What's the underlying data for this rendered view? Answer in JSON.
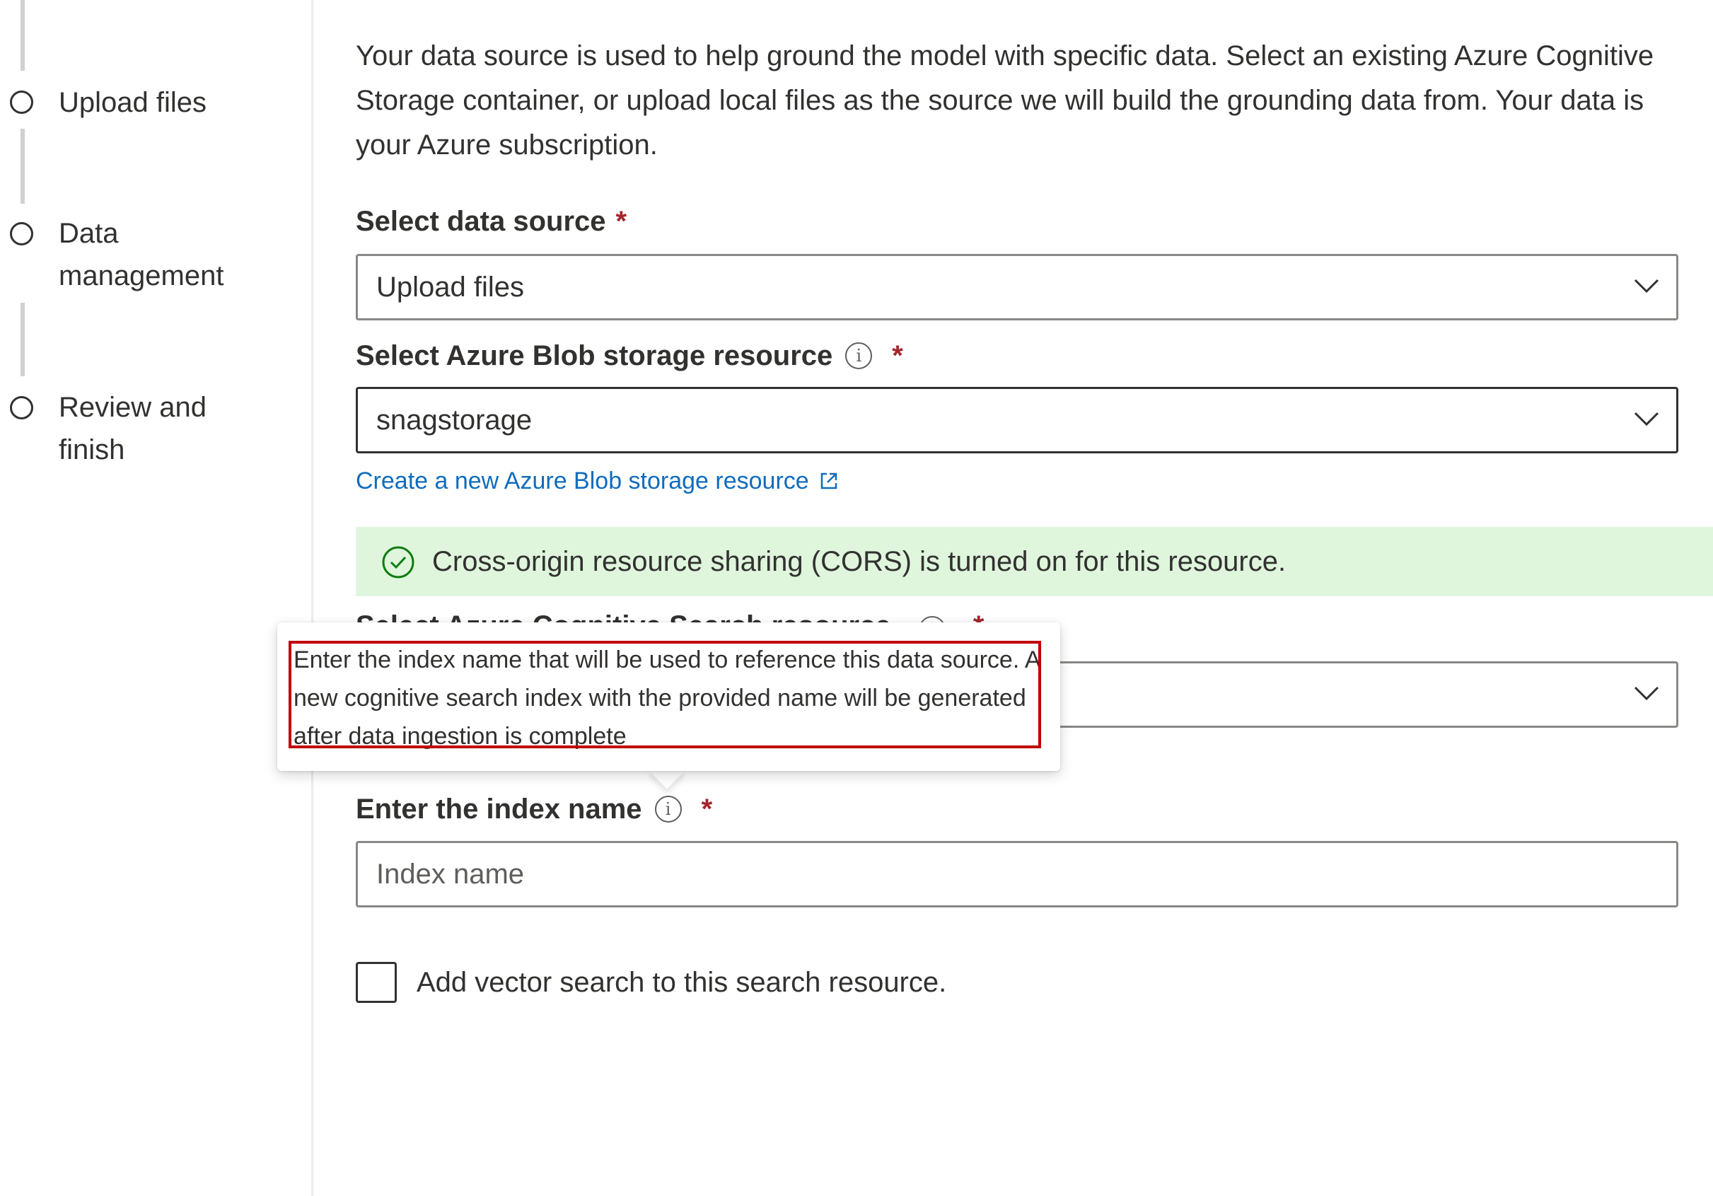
{
  "steps": [
    {
      "label": "Upload files"
    },
    {
      "label": "Data management"
    },
    {
      "label": "Review and finish"
    }
  ],
  "intro": {
    "line1": "Your data source is used to help ground the model with specific data. Select an existing Azure Cognitive",
    "line2": "Storage container, or upload local files as the source we will build the grounding data from. Your data is",
    "line3": "your Azure subscription."
  },
  "data_source": {
    "label": "Select data source",
    "required_mark": "*",
    "value": "Upload files"
  },
  "blob_storage": {
    "label": "Select Azure Blob storage resource",
    "required_mark": "*",
    "value": "snagstorage",
    "create_link": "Create a new Azure Blob storage resource"
  },
  "cors_banner": {
    "message": "Cross-origin resource sharing (CORS) is turned on for this resource."
  },
  "search_resource": {
    "label": "Select Azure Cognitive Search resource",
    "required_mark": "*"
  },
  "index_name": {
    "label": "Enter the index name",
    "required_mark": "*",
    "placeholder": "Index name",
    "tooltip": "Enter the index name that will be used to reference this data source. A new cognitive search index with the provided name will be generated after data ingestion is complete"
  },
  "vector_search": {
    "label": "Add vector search to this search resource.",
    "checked": false
  },
  "colors": {
    "link": "#0f6cbd",
    "required": "#a4262c",
    "success_bg": "#dff6dd",
    "success_icon": "#107c10",
    "highlight": "#c00000"
  },
  "icons": {
    "info": "info-circle-icon",
    "chevron": "chevron-down-icon",
    "external": "open-in-new-window-icon",
    "success": "checkmark-circle-icon"
  }
}
